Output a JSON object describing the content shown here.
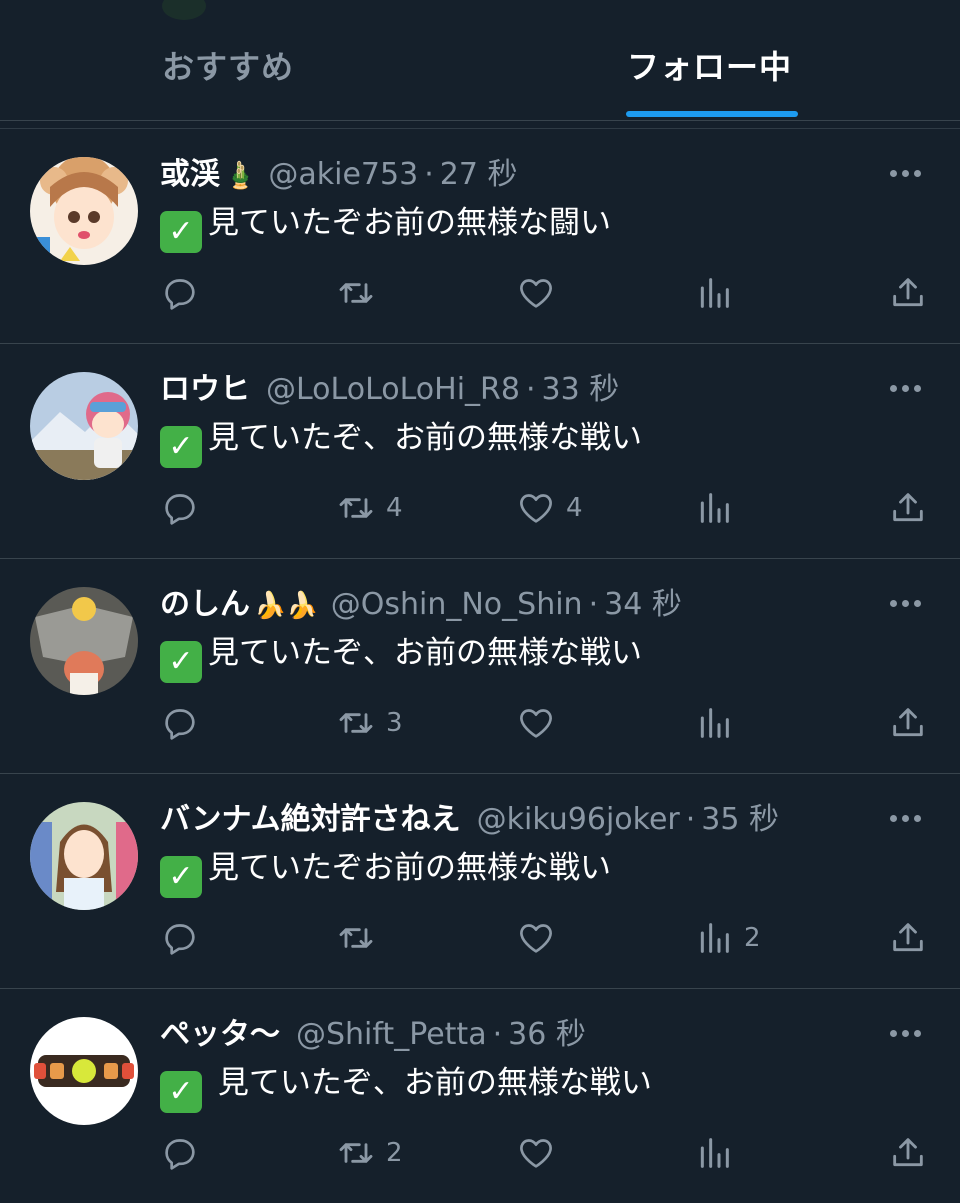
{
  "tabs": {
    "recommended": "おすすめ",
    "following": "フォロー中"
  },
  "tweets": [
    {
      "name": "或渓",
      "name_emoji": "🎍",
      "handle": "@akie753",
      "time": "27 秒",
      "check": "✓",
      "text": "見ていたぞお前の無様な闘い",
      "retweets": "",
      "likes": "",
      "views": ""
    },
    {
      "name": "ロウヒ",
      "name_emoji": "",
      "handle": "@LoLoLoLoHi_R8",
      "time": "33 秒",
      "check": "✓",
      "text": "見ていたぞ、お前の無様な戦い",
      "retweets": "4",
      "likes": "4",
      "views": ""
    },
    {
      "name": "のしん",
      "name_emoji": "🍌🍌",
      "handle": "@Oshin_No_Shin",
      "time": "34 秒",
      "check": "✓",
      "text": "見ていたぞ、お前の無様な戦い",
      "retweets": "3",
      "likes": "",
      "views": ""
    },
    {
      "name": "バンナム絶対許さねえ",
      "name_emoji": "",
      "handle": "@kiku96joker",
      "time": "35 秒",
      "check": "✓",
      "text": "見ていたぞお前の無様な戦い",
      "retweets": "",
      "likes": "",
      "views": "2"
    },
    {
      "name": "ペッタ〜",
      "name_emoji": "",
      "handle": "@Shift_Petta",
      "time": "36 秒",
      "check": "✓",
      "text": " 見ていたぞ、お前の無様な戦い",
      "retweets": "2",
      "likes": "",
      "views": ""
    }
  ],
  "icons": {
    "reply": "reply-icon",
    "retweet": "retweet-icon",
    "like": "heart-icon",
    "views": "views-icon",
    "share": "share-icon",
    "more": "more-icon"
  },
  "colors": {
    "background": "#15202b",
    "accent": "#1d9bf0",
    "muted": "#8b98a5",
    "check_green": "#43b047"
  }
}
